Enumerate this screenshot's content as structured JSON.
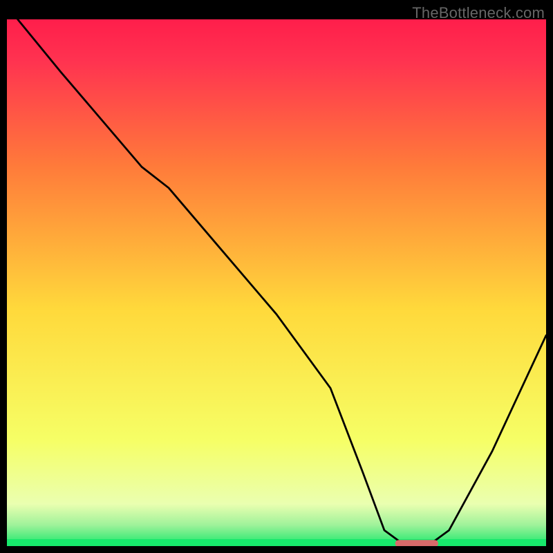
{
  "watermark": "TheBottleneck.com",
  "chart_data": {
    "type": "line",
    "title": "",
    "xlabel": "",
    "ylabel": "",
    "xlim": [
      0,
      100
    ],
    "ylim": [
      0,
      100
    ],
    "background_gradient": {
      "top": "#ff1e4b",
      "mid_upper": "#ff7b3a",
      "mid": "#ffd93b",
      "mid_lower": "#f6ff66",
      "low_band": "#eaffb0",
      "bottom": "#17e86b"
    },
    "series": [
      {
        "name": "bottleneck-curve",
        "color": "#000000",
        "x": [
          2,
          10,
          20,
          25,
          30,
          40,
          50,
          60,
          66,
          70,
          74,
          78,
          82,
          90,
          100
        ],
        "y": [
          100,
          90,
          78,
          72,
          68,
          56,
          44,
          30,
          14,
          3,
          0,
          0,
          3,
          18,
          40
        ]
      }
    ],
    "marker": {
      "name": "optimal-range-marker",
      "color": "#d86a6a",
      "x_start": 72,
      "x_end": 80,
      "y": 0.5,
      "radius": 3
    }
  }
}
